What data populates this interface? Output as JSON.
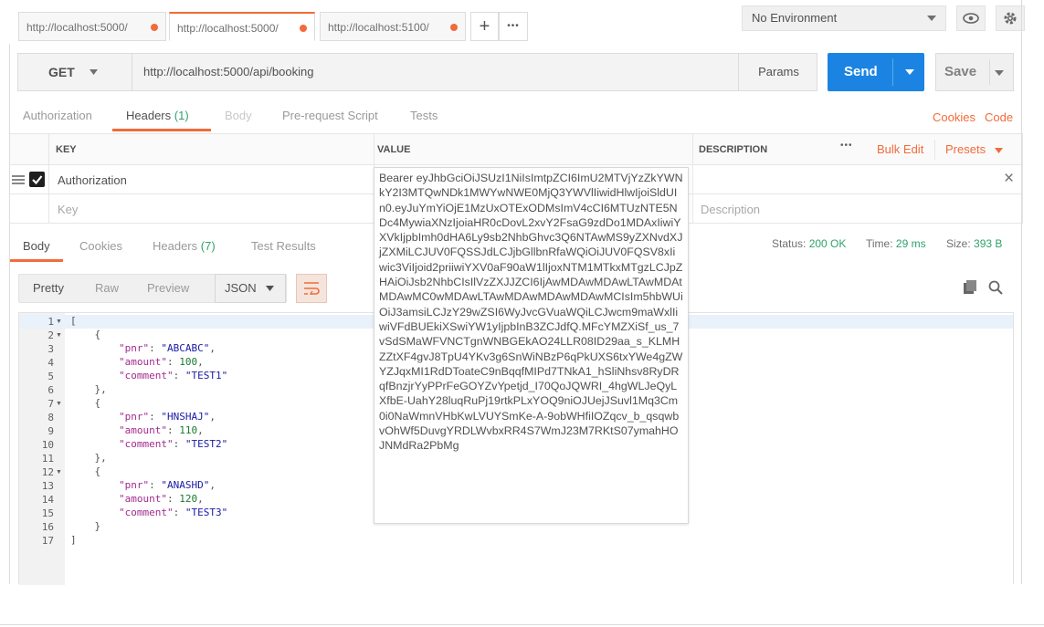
{
  "tabs": [
    {
      "label": "http://localhost:5000/"
    },
    {
      "label": "http://localhost:5000/"
    },
    {
      "label": "http://localhost:5100/"
    }
  ],
  "tab_add": "+",
  "tab_more": "•••",
  "environment": {
    "selected": "No Environment"
  },
  "request": {
    "method": "GET",
    "url": "http://localhost:5000/api/booking",
    "params_label": "Params",
    "send_label": "Send",
    "save_label": "Save"
  },
  "request_tabs": {
    "authorization": "Authorization",
    "headers": "Headers",
    "headers_count": "(1)",
    "body": "Body",
    "prerequest": "Pre-request Script",
    "tests": "Tests",
    "cookies": "Cookies",
    "code": "Code"
  },
  "headers_table": {
    "col_key": "KEY",
    "col_value": "VALUE",
    "col_description": "DESCRIPTION",
    "more": "•••",
    "bulk_edit": "Bulk Edit",
    "presets": "Presets",
    "row_key": "Authorization",
    "placeholder_key": "Key",
    "placeholder_description": "Description",
    "delete": "×"
  },
  "value_popup": {
    "text": "Bearer eyJhbGciOiJSUzI1NiIsImtpZCI6ImU2MTVjYzZkYWNkY2I3MTQwNDk1MWYwNWE0MjQ3YWVlIiwidHlwIjoiSldUIn0.eyJuYmYiOjE1MzUxOTExODMsImV4cCI6MTUzNTE5NDc4MywiaXNzIjoiaHR0cDovL2xvY2FsaG9zdDo1MDAxIiwiYXVkIjpbImh0dHA6Ly9sb2NhbGhvc3Q6NTAwMS9yZXNvdXJjZXMiLCJUV0FQSSJdLCJjbGllbnRfaWQiOiJUV0FQSV8xIiwic3ViIjoid2priiwiYXV0aF90aW1lIjoxNTM1MTkxMTgzLCJpZHAiOiJsb2NhbCIsIlVzZXJJZCI6IjAwMDAwMDAwLTAwMDAtMDAwMC0wMDAwLTAwMDAwMDAwMDAwMCIsIm5hbWUiOiJ3amsiLCJzY29wZSI6WyJvcGVuaWQiLCJwcm9maWxlIiwiVFdBUEkiXSwiYW1yIjpbInB3ZCJdfQ.MFcYMZXiSf_us_7vSdSMaWFVNCTgnWNBGEkAO24LLR08ID29aa_s_KLMHZZtXF4gvJ8TpU4YKv3g6SnWiNBzP6qPkUXS6txYWe4gZWYZJqxMI1RdDToateC9nBqqfMIPd7TNkA1_hSliNhsv8RyDRqfBnzjrYyPPrFeGOYZvYpetjd_I70QoJQWRI_4hgWLJeQyLXfbE-UahY28luqRuPj19rtkPLxYOQ9niOJUejJSuvl1Mq3Cm0i0NaWmnVHbKwLVUYSmKe-A-9obWHfiIOZqcv_b_qsqwbvOhWf5DuvgYRDLWvbxRR4S7WmJ23M7RKtS07ymahHOJNMdRa2PbMg"
  },
  "response": {
    "tabs": {
      "body": "Body",
      "cookies": "Cookies",
      "headers": "Headers",
      "headers_count": "(7)",
      "test_results": "Test Results"
    },
    "status_label": "Status:",
    "status_value": "200 OK",
    "time_label": "Time:",
    "time_value": "29 ms",
    "size_label": "Size:",
    "size_value": "393 B",
    "view": {
      "pretty": "Pretty",
      "raw": "Raw",
      "preview": "Preview",
      "format": "JSON"
    }
  },
  "code": {
    "line_numbers": [
      "1",
      "2",
      "3",
      "4",
      "5",
      "6",
      "7",
      "8",
      "9",
      "10",
      "11",
      "12",
      "13",
      "14",
      "15",
      "16",
      "17"
    ],
    "bookings": [
      {
        "pnr": "\"ABCABC\"",
        "amount": "100",
        "comment": "\"TEST1\""
      },
      {
        "pnr": "\"HNSHAJ\"",
        "amount": "110",
        "comment": "\"TEST2\""
      },
      {
        "pnr": "\"ANASHD\"",
        "amount": "120",
        "comment": "\"TEST3\""
      }
    ],
    "key_pnr": "\"pnr\"",
    "key_amount": "\"amount\"",
    "key_comment": "\"comment\""
  },
  "colors": {
    "accent": "#f26b3a",
    "send": "#1b84e2",
    "status_ok": "#2fa36b"
  }
}
